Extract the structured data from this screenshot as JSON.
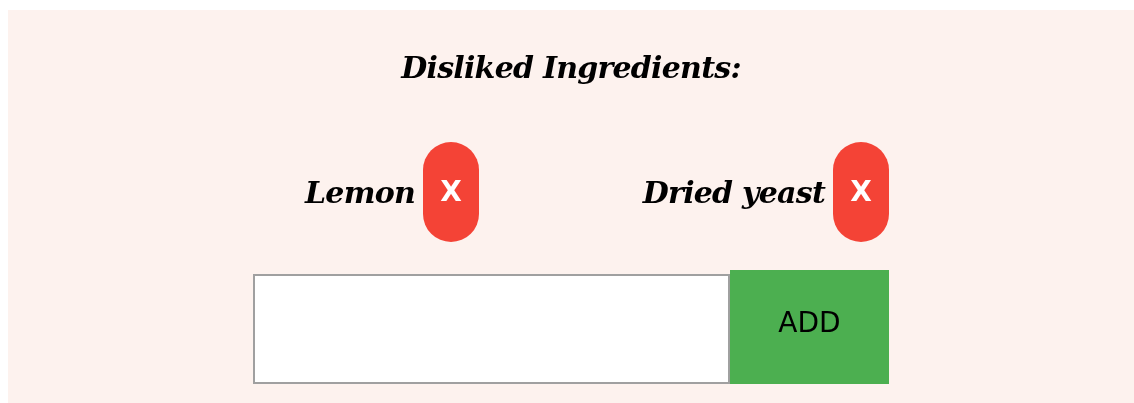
{
  "title": "Disliked Ingredients:",
  "ingredients": [
    {
      "name": "Lemon",
      "remove": "X"
    },
    {
      "name": "Dried yeast",
      "remove": "X"
    }
  ],
  "add_button": "ADD"
}
